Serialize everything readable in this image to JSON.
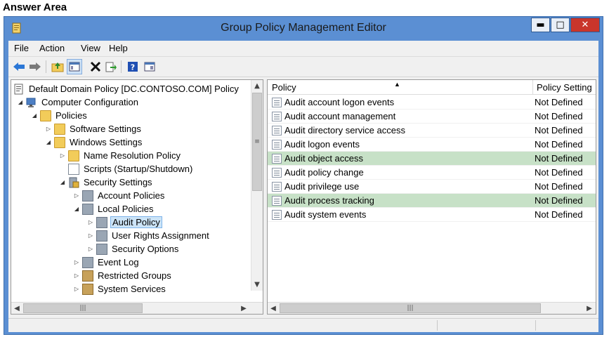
{
  "answer_area": "Answer Area",
  "window": {
    "title": "Group Policy Management Editor",
    "controls": {
      "minimize": "▬",
      "maximize": "□",
      "close": "✕"
    }
  },
  "menu": [
    "File",
    "Action",
    "View",
    "Help"
  ],
  "toolbar": [
    "back-icon",
    "forward-icon",
    "up-folder-icon",
    "show-tree-icon",
    "delete-icon",
    "export-icon",
    "help-icon",
    "properties-icon"
  ],
  "tree": {
    "items": [
      {
        "label": "Default Domain Policy [DC.CONTOSO.COM] Policy",
        "expander": "",
        "icon": "gpo-icon"
      },
      {
        "label": "Computer Configuration",
        "expander": "◢",
        "icon": "computer-icon"
      },
      {
        "label": "Policies",
        "expander": "◢",
        "icon": "folder-icon"
      },
      {
        "label": "Software Settings",
        "expander": "▷",
        "icon": "folder-icon"
      },
      {
        "label": "Windows Settings",
        "expander": "◢",
        "icon": "folder-icon"
      },
      {
        "label": "Name Resolution Policy",
        "expander": "▷",
        "icon": "folder-icon"
      },
      {
        "label": "Scripts (Startup/Shutdown)",
        "expander": "",
        "icon": "script-icon"
      },
      {
        "label": "Security Settings",
        "expander": "◢",
        "icon": "security-icon"
      },
      {
        "label": "Account Policies",
        "expander": "▷",
        "icon": "policy-folder-icon"
      },
      {
        "label": "Local Policies",
        "expander": "◢",
        "icon": "policy-folder-icon"
      },
      {
        "label": "Audit Policy",
        "expander": "▷",
        "icon": "policy-folder-icon"
      },
      {
        "label": "User Rights Assignment",
        "expander": "▷",
        "icon": "policy-folder-icon"
      },
      {
        "label": "Security Options",
        "expander": "▷",
        "icon": "policy-folder-icon"
      },
      {
        "label": "Event Log",
        "expander": "▷",
        "icon": "policy-folder-icon"
      },
      {
        "label": "Restricted Groups",
        "expander": "▷",
        "icon": "lock-folder-icon"
      },
      {
        "label": "System Services",
        "expander": "▷",
        "icon": "lock-folder-icon"
      }
    ],
    "selected_label": "Audit Policy"
  },
  "list": {
    "columns": [
      "Policy",
      "Policy Setting"
    ],
    "sort_indicator": "▲",
    "rows": [
      {
        "policy": "Audit account logon events",
        "setting": "Not Defined",
        "highlighted": false
      },
      {
        "policy": "Audit account management",
        "setting": "Not Defined",
        "highlighted": false
      },
      {
        "policy": "Audit directory service access",
        "setting": "Not Defined",
        "highlighted": false
      },
      {
        "policy": "Audit logon events",
        "setting": "Not Defined",
        "highlighted": false
      },
      {
        "policy": "Audit object access",
        "setting": "Not Defined",
        "highlighted": true
      },
      {
        "policy": "Audit policy change",
        "setting": "Not Defined",
        "highlighted": false
      },
      {
        "policy": "Audit privilege use",
        "setting": "Not Defined",
        "highlighted": false
      },
      {
        "policy": "Audit process tracking",
        "setting": "Not Defined",
        "highlighted": true
      },
      {
        "policy": "Audit system events",
        "setting": "Not Defined",
        "highlighted": false
      }
    ]
  },
  "colors": {
    "title_bar": "#5b8fd3",
    "highlight_row": "#c7e1c7",
    "selection": "#cce4f7"
  }
}
